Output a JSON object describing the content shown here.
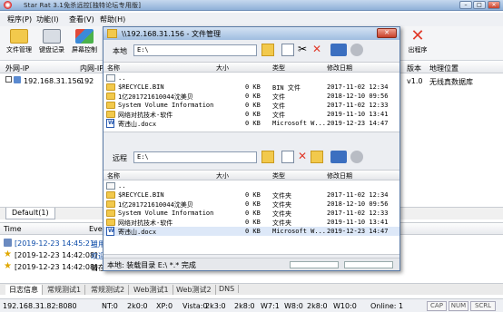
{
  "window": {
    "title": "Star Rat 3.1免杀远控[独特论坛专用版]"
  },
  "menu": [
    "程序(P)",
    "功能(I)",
    "查看(V)",
    "帮助(H)"
  ],
  "toolbar": {
    "file_manager": "文件管理",
    "keylog": "键盘记录",
    "screen": "屏幕控制",
    "exit": "出程序"
  },
  "columns": {
    "wan_ip": "外网-IP",
    "lan_ip": "内网-IP",
    "version": "版本",
    "location": "地理位置"
  },
  "hosts": [
    {
      "wan_ip": "192.168.31.156",
      "lan_ip": "192",
      "version": "v1.0",
      "location": "无线真数据库"
    }
  ],
  "tabs": {
    "default": "Default(1)"
  },
  "log": {
    "col_time": "Time",
    "col_event": "Eve",
    "rows": [
      {
        "time": "[2019-12-23 14:45:21]",
        "event": "主用"
      },
      {
        "time": "[2019-12-23 14:42:08]",
        "event": "欢迎"
      },
      {
        "time": "[2019-12-23 14:42:08]",
        "event": "请在"
      }
    ]
  },
  "bottom_tabs": [
    "日志信息",
    "常规测试1",
    "常规测试2",
    "Web测试1",
    "Web测试2",
    "DNS"
  ],
  "status": {
    "addr": "192.168.31.82:8080",
    "nt": "NT:0",
    "k2": "2k0:0",
    "xp": "XP:0",
    "vista": "Vista:0",
    "k3": "2k3:0",
    "w7": "W7:1",
    "w8": "W8:0",
    "k8": "2k8:0",
    "w10": "W10:0",
    "online": "Online: 1",
    "cap": "CAP",
    "num": "NUM",
    "scrl": "SCRL"
  },
  "fm": {
    "title": "\\\\192.168.31.156 - 文件管理",
    "local_label": "本地",
    "local_path": "E:\\",
    "remote_label": "远程",
    "remote_path": "E:\\",
    "cols": {
      "name": "名称",
      "size": "大小",
      "type": "类型",
      "date": "修改日期"
    },
    "local_files": [
      {
        "name": "..",
        "size": "",
        "type": "",
        "date": ""
      },
      {
        "name": "$RECYCLE.BIN",
        "size": "0 KB",
        "type": "BIN 文件",
        "date": "2017-11-02 12:34"
      },
      {
        "name": "1亿201721610044沈美贝",
        "size": "0 KB",
        "type": "文件",
        "date": "2018-12-10 09:56"
      },
      {
        "name": "System Volume Information",
        "size": "0 KB",
        "type": "文件",
        "date": "2017-11-02 12:33"
      },
      {
        "name": "网络对抗技术-软件",
        "size": "0 KB",
        "type": "文件",
        "date": "2019-11-10 13:41"
      },
      {
        "name": "寄违山.docx",
        "size": "0 KB",
        "type": "Microsoft W...",
        "date": "2019-12-23 14:47"
      }
    ],
    "remote_files": [
      {
        "name": "..",
        "size": "",
        "type": "",
        "date": ""
      },
      {
        "name": "$RECYCLE.BIN",
        "size": "0 KB",
        "type": "文件夹",
        "date": "2017-11-02 12:34"
      },
      {
        "name": "1亿201721610044沈美贝",
        "size": "0 KB",
        "type": "文件夹",
        "date": "2018-12-10 09:56"
      },
      {
        "name": "System Volume Information",
        "size": "0 KB",
        "type": "文件夹",
        "date": "2017-11-02 12:33"
      },
      {
        "name": "网络对抗技术-软件",
        "size": "0 KB",
        "type": "文件夹",
        "date": "2019-11-10 13:41"
      },
      {
        "name": "寄违山.docx",
        "size": "0 KB",
        "type": "Microsoft W...",
        "date": "2019-12-23 14:47"
      }
    ],
    "status": "本地: 装载目录 E:\\ *.* 完成"
  },
  "colors": {
    "accent": "#0a4aa8",
    "title_bar": "#9fbde0",
    "folder": "#f2c94c"
  }
}
